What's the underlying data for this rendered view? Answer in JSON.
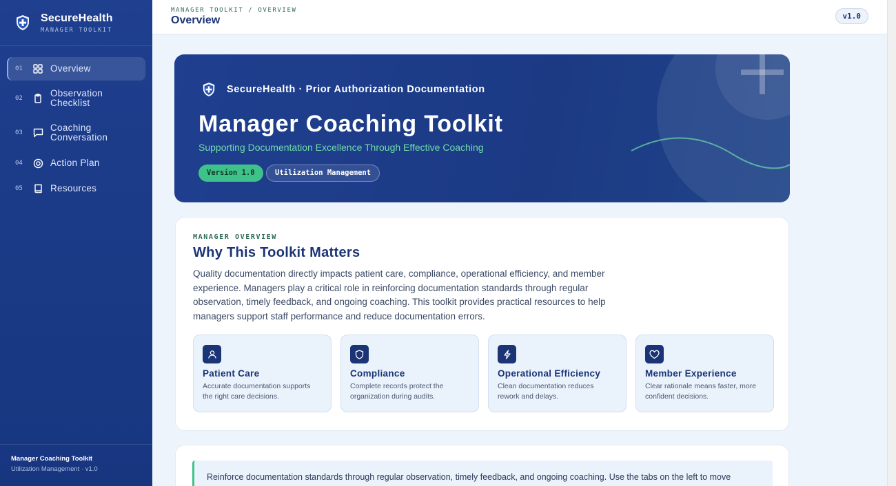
{
  "brand": {
    "name": "SecureHealth",
    "subtitle": "MANAGER TOOLKIT"
  },
  "nav": [
    {
      "num": "01",
      "label": "Overview",
      "icon": "grid-icon",
      "active": true
    },
    {
      "num": "02",
      "label": "Observation Checklist",
      "icon": "clipboard-icon"
    },
    {
      "num": "03",
      "label": "Coaching Conversation",
      "icon": "chat-icon"
    },
    {
      "num": "04",
      "label": "Action Plan",
      "icon": "target-icon"
    },
    {
      "num": "05",
      "label": "Resources",
      "icon": "book-icon"
    }
  ],
  "sidebar_footer": {
    "title": "Manager Coaching Toolkit",
    "subtitle": "Utilization Management · v1.0"
  },
  "topbar": {
    "breadcrumb": "MANAGER TOOLKIT / OVERVIEW",
    "title": "Overview",
    "version": "v1.0"
  },
  "hero": {
    "brand_line": "SecureHealth · Prior Authorization Documentation",
    "title": "Manager Coaching Toolkit",
    "subtitle": "Supporting Documentation Excellence Through Effective Coaching",
    "chips": [
      "Version 1.0",
      "Utilization Management"
    ]
  },
  "overview": {
    "eyebrow": "MANAGER OVERVIEW",
    "title": "Why This Toolkit Matters",
    "body": "Quality documentation directly impacts patient care, compliance, operational efficiency, and member experience. Managers play a critical role in reinforcing documentation standards through regular observation, timely feedback, and ongoing coaching. This toolkit provides practical resources to help managers support staff performance and reduce documentation errors.",
    "features": [
      {
        "icon": "user-icon",
        "title": "Patient Care",
        "text": "Accurate documentation supports the right care decisions."
      },
      {
        "icon": "shield-icon",
        "title": "Compliance",
        "text": "Complete records protect the organization during audits."
      },
      {
        "icon": "bolt-icon",
        "title": "Operational Efficiency",
        "text": "Clean documentation reduces rework and delays."
      },
      {
        "icon": "heart-icon",
        "title": "Member Experience",
        "text": "Clear rationale means faster, more confident decisions."
      }
    ]
  },
  "tip": {
    "text": "Reinforce documentation standards through regular observation, timely feedback, and ongoing coaching. Use the tabs on the left to move through each part of the toolkit."
  },
  "colors": {
    "sidebar": "#1f3f8f",
    "accent_green": "#3ec28a",
    "navy": "#1a3476"
  }
}
